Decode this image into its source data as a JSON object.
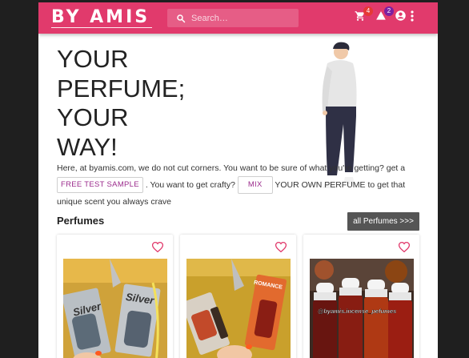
{
  "header": {
    "brand": "BY AMIS",
    "search_placeholder": "Search…",
    "cart_count": "4",
    "notifications_count": "2",
    "colors": {
      "bar": "#e13a6c",
      "cart_badge": "#e53935",
      "notif_badge": "#7b1fa2"
    }
  },
  "hero": {
    "title_lines": [
      "YOUR",
      "PERFUME;",
      "YOUR",
      "WAY!"
    ],
    "text_1": "Here, at byamis.com, we do not cut corners. You want to be sure of what you're getting? get a",
    "free_sample_chip": "FREE TEST SAMPLE",
    "text_2": ". You want to get crafty?",
    "mix_chip": "MIX",
    "text_3": "YOUR OWN PERFUME to get that unique scent you always crave"
  },
  "perfumes": {
    "title": "Perfumes",
    "all_button": "all Perfumes >>>",
    "cards": [
      {
        "image_label": "Silver",
        "image_label_2": "Silver"
      },
      {
        "image_label": "ROMANCE"
      },
      {
        "image_label": "@byamis.incense_pefumes"
      }
    ]
  }
}
